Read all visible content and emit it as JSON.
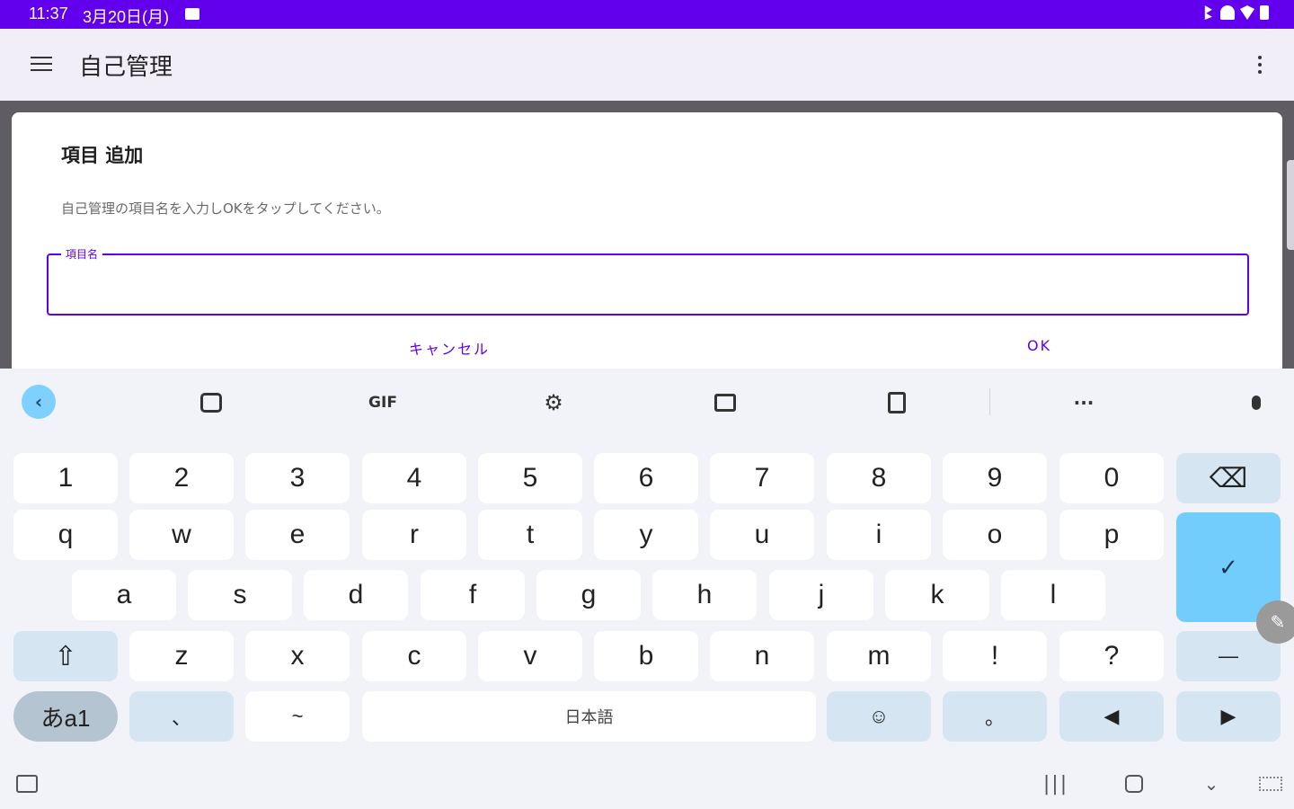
{
  "status_bar": {
    "time": "11:37",
    "date": "3月20日(月)",
    "background": "#6200ee"
  },
  "app_bar": {
    "title": "自己管理",
    "menu_icon": "hamburger-menu-icon",
    "overflow_icon": "more-vert-icon"
  },
  "dialog": {
    "title": "項目 追加",
    "message": "自己管理の項目名を入力しOKをタップしてください。",
    "field_label": "項目名",
    "field_value": "",
    "cancel_label": "キャンセル",
    "ok_label": "OK",
    "accent": "#6200ee"
  },
  "keyboard": {
    "toolbar": {
      "collapse_glyph": "‹",
      "gif_label": "GIF",
      "settings_glyph": "⚙",
      "more_glyph": "···"
    },
    "number_row": [
      "1",
      "2",
      "3",
      "4",
      "5",
      "6",
      "7",
      "8",
      "9",
      "0"
    ],
    "row1": [
      "q",
      "w",
      "e",
      "r",
      "t",
      "y",
      "u",
      "i",
      "o",
      "p"
    ],
    "row2": [
      "a",
      "s",
      "d",
      "f",
      "g",
      "h",
      "j",
      "k",
      "l"
    ],
    "row3": [
      "z",
      "x",
      "c",
      "v",
      "b",
      "n",
      "m",
      "!",
      "?"
    ],
    "backspace_glyph": "⌫",
    "enter_glyph": "✓",
    "shift_glyph": "⇧",
    "dash_glyph": "—",
    "lang_key": "あa1",
    "comma_key": "、",
    "tilde_key": "~",
    "space_label": "日本語",
    "emoji_glyph": "☺",
    "period_key": "。",
    "left_arrow": "◀",
    "right_arrow": "▶",
    "accent": "#72cdfc"
  },
  "nav_bar": {
    "recents_glyph": "|||",
    "hide_glyph": "⌄"
  }
}
